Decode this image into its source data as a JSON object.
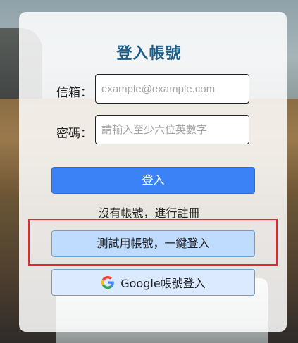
{
  "login": {
    "title": "登入帳號",
    "email_label": "信箱：",
    "email_placeholder": "example@example.com",
    "password_label": "密碼：",
    "password_placeholder": "請輸入至少六位英數字",
    "login_button": "登入",
    "register_text": "沒有帳號，進行註冊",
    "test_account_button": "測試用帳號，一鍵登入",
    "google_button": "Google帳號登入",
    "google_icon": "google-g-icon"
  },
  "colors": {
    "title": "#1f5f87",
    "primary": "#3b82f6",
    "test_button": "#bfdbfe",
    "google_button": "#dbeafe",
    "highlight_box": "#e5262b"
  }
}
